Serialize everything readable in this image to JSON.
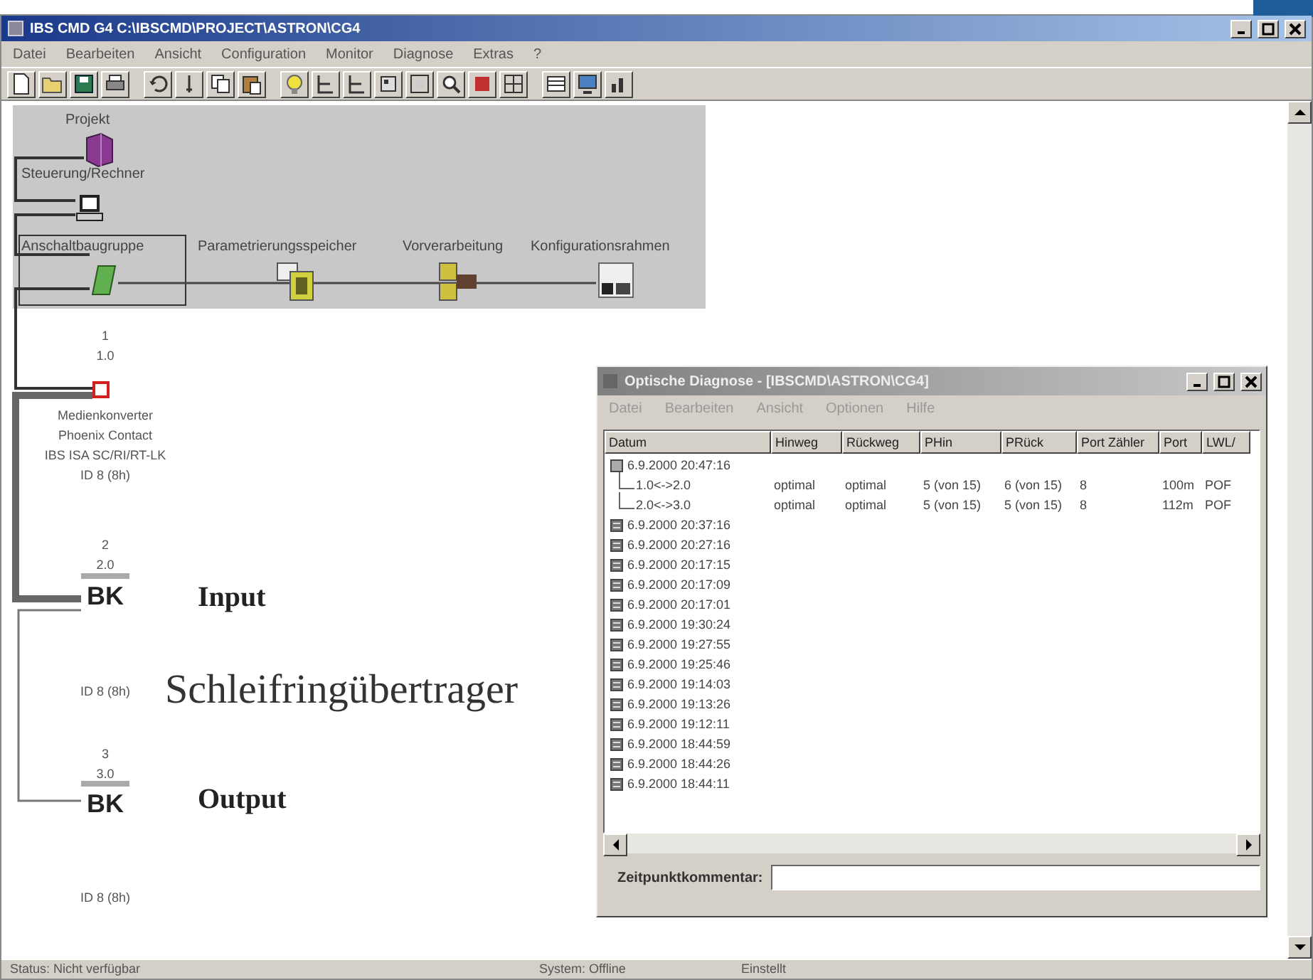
{
  "window": {
    "title": "IBS CMD G4 C:\\IBSCMD\\PROJECT\\ASTRON\\CG4"
  },
  "menu": [
    "Datei",
    "Bearbeiten",
    "Ansicht",
    "Configuration",
    "Monitor",
    "Diagnose",
    "Extras",
    "?"
  ],
  "diagram": {
    "nodes": [
      {
        "kind": "project",
        "label": "Projekt"
      },
      {
        "kind": "controller",
        "label": "Steuerung/Rechner"
      },
      {
        "kind": "interface",
        "label": "Anschaltbaugruppe"
      },
      {
        "kind": "memory",
        "label": "Parametrierungsspeicher"
      },
      {
        "kind": "preprocessing",
        "label": "Vorverarbeitung"
      },
      {
        "kind": "configuration",
        "label": "Konfigurationsrahmen"
      }
    ],
    "devices": [
      {
        "kind": "converter",
        "number": "1",
        "address": "1.0",
        "lines": [
          "Medienkonverter",
          "Phoenix Contact",
          "IBS ISA SC/RI/RT-LK",
          "ID 8 (8h)"
        ]
      },
      {
        "kind": "bus-terminal",
        "number": "2",
        "address": "2.0",
        "icon_text": "BK",
        "lines": [
          "ID 8 (8h)"
        ]
      },
      {
        "kind": "bus-terminal",
        "number": "3",
        "address": "3.0",
        "icon_text": "BK",
        "lines": [
          "ID 8 (8h)"
        ]
      }
    ]
  },
  "annotations": [
    {
      "kind": "heading",
      "text": "Input"
    },
    {
      "kind": "caption",
      "text": "Schleifringübertrager"
    },
    {
      "kind": "heading",
      "text": "Output"
    }
  ],
  "diagnosis_window": {
    "title": "Optische Diagnose - [IBSCMD\\ASTRON\\CG4]",
    "menu": [
      "Datei",
      "Bearbeiten",
      "Ansicht",
      "Optionen",
      "Hilfe"
    ],
    "columns": [
      "Datum",
      "Hinweg",
      "Rückweg",
      "PHin",
      "PRück",
      "Port Zähler",
      "Port",
      "LWL/"
    ],
    "rows": [
      {
        "date": "6.9.2000 20:47:16",
        "expanded": true,
        "children": [
          {
            "link": "1.0<->2.0",
            "cells": [
              "optimal",
              "optimal",
              "5 (von 15)",
              "6 (von 15)",
              "8",
              "100m",
              "POF"
            ]
          },
          {
            "link": "2.0<->3.0",
            "cells": [
              "optimal",
              "optimal",
              "5 (von 15)",
              "5 (von 15)",
              "8",
              "112m",
              "POF"
            ]
          }
        ]
      },
      {
        "date": "6.9.2000 20:37:16",
        "expanded": false
      },
      {
        "date": "6.9.2000 20:27:16",
        "expanded": false
      },
      {
        "date": "6.9.2000 20:17:15",
        "expanded": false
      },
      {
        "date": "6.9.2000 20:17:09",
        "expanded": false
      },
      {
        "date": "6.9.2000 20:17:01",
        "expanded": false
      },
      {
        "date": "6.9.2000 19:30:24",
        "expanded": false
      },
      {
        "date": "6.9.2000 19:27:55",
        "expanded": false
      },
      {
        "date": "6.9.2000 19:25:46",
        "expanded": false
      },
      {
        "date": "6.9.2000 19:14:03",
        "expanded": false
      },
      {
        "date": "6.9.2000 19:13:26",
        "expanded": false
      },
      {
        "date": "6.9.2000 19:12:11",
        "expanded": false
      },
      {
        "date": "6.9.2000 18:44:59",
        "expanded": false
      },
      {
        "date": "6.9.2000 18:44:26",
        "expanded": false
      },
      {
        "date": "6.9.2000 18:44:11",
        "expanded": false
      }
    ],
    "comment_label": "Zeitpunktkommentar:"
  },
  "status_bar": [
    "Status: Nicht verfügbar",
    "System: Offline",
    "Einstellt"
  ]
}
